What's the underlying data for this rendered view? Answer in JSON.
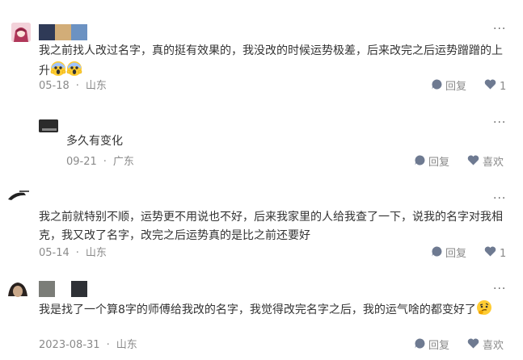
{
  "comments": [
    {
      "text": "我之前找人改过名字，真的挺有效果的，我没改的时候运势极差，后来改完之后运势蹭蹭的上升",
      "date": "05-18",
      "location": "山东",
      "reply_label": "回复",
      "like_label": "1"
    },
    {
      "text": "多久有变化",
      "date": "09-21",
      "location": "广东",
      "reply_label": "回复",
      "like_label": "喜欢"
    },
    {
      "text": "我之前就特别不顺，运势更不用说也不好，后来我家里的人给我查了一下，说我的名字对我相克，我又改了名字，改完之后运势真的是比之前还要好",
      "date": "05-14",
      "location": "山东",
      "reply_label": "回复",
      "like_label": "1"
    },
    {
      "text": "我是找了一个算8字的师傅给我改的名字，我觉得改完名字之后，我的运气啥的都变好了",
      "date": "2023-08-31",
      "location": "山东",
      "reply_label": "回复",
      "like_label": "喜欢"
    }
  ],
  "colors": {
    "text": "#333333",
    "meta": "#8a8a8a",
    "icon": "#6e7a91"
  },
  "icons": {
    "more": "more-dots-icon",
    "reply": "reply-bubble-icon",
    "like": "heart-icon",
    "emoji_scream": "scream-emoji-icon",
    "emoji_thinking": "thinking-emoji-icon"
  }
}
